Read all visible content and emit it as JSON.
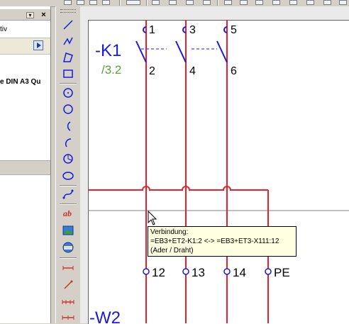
{
  "left_panel": {
    "pin_label": "▾",
    "close_label": "×",
    "partial_text": "tiv",
    "sheet_format_text": "e DIN A3 Qu"
  },
  "schematic": {
    "device_tag": "-K1",
    "device_reference": "/3.2",
    "cable_tag": "-W2",
    "top_pins": [
      "1",
      "3",
      "5"
    ],
    "bottom_pins": [
      "2",
      "4",
      "6"
    ],
    "terminals": [
      "12",
      "13",
      "14",
      "PE"
    ]
  },
  "tooltip": {
    "line1": "Verbindung:",
    "line2": "=EB3+ET2-K1:2 <-> =EB3+ET3-X111:12",
    "line3": "(Ader / Draht)"
  },
  "colors": {
    "wire": "#e8202a",
    "symbol": "#1a1adc",
    "tag": "#1a1adc",
    "reference": "#5aa23a",
    "tooltip_bg": "#ffffe1"
  }
}
